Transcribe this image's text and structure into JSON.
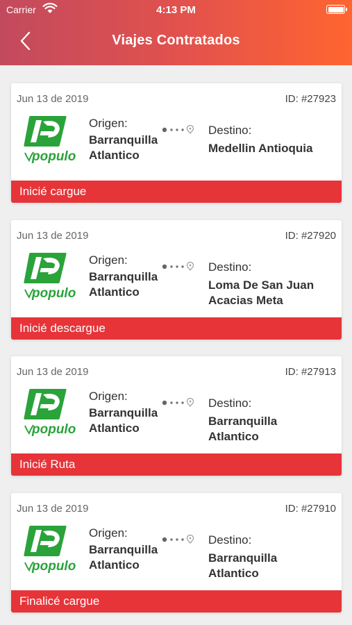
{
  "status_bar": {
    "carrier": "Carrier",
    "time": "4:13 PM"
  },
  "header": {
    "title": "Viajes Contratados"
  },
  "labels": {
    "origin": "Origen:",
    "destination": "Destino:"
  },
  "logo": {
    "text": "populo"
  },
  "colors": {
    "accent": "#e63439",
    "brand_green": "#2aa33a"
  },
  "trips": [
    {
      "date": "Jun 13 de 2019",
      "id": "ID: #27923",
      "origin_1": "Barranquilla",
      "origin_2": "Atlantico",
      "dest_1": "Medellin Antioquia",
      "dest_2": "",
      "status": "Inicié cargue"
    },
    {
      "date": "Jun 13 de 2019",
      "id": "ID: #27920",
      "origin_1": "Barranquilla",
      "origin_2": "Atlantico",
      "dest_1": "Loma De San Juan",
      "dest_2": "Acacias Meta",
      "status": "Inicié descargue"
    },
    {
      "date": "Jun 13 de 2019",
      "id": "ID: #27913",
      "origin_1": "Barranquilla",
      "origin_2": "Atlantico",
      "dest_1": "Barranquilla",
      "dest_2": "Atlantico",
      "status": "Inicié Ruta"
    },
    {
      "date": "Jun 13 de 2019",
      "id": "ID: #27910",
      "origin_1": "Barranquilla",
      "origin_2": "Atlantico",
      "dest_1": "Barranquilla",
      "dest_2": "Atlantico",
      "status": "Finalicé cargue"
    }
  ]
}
